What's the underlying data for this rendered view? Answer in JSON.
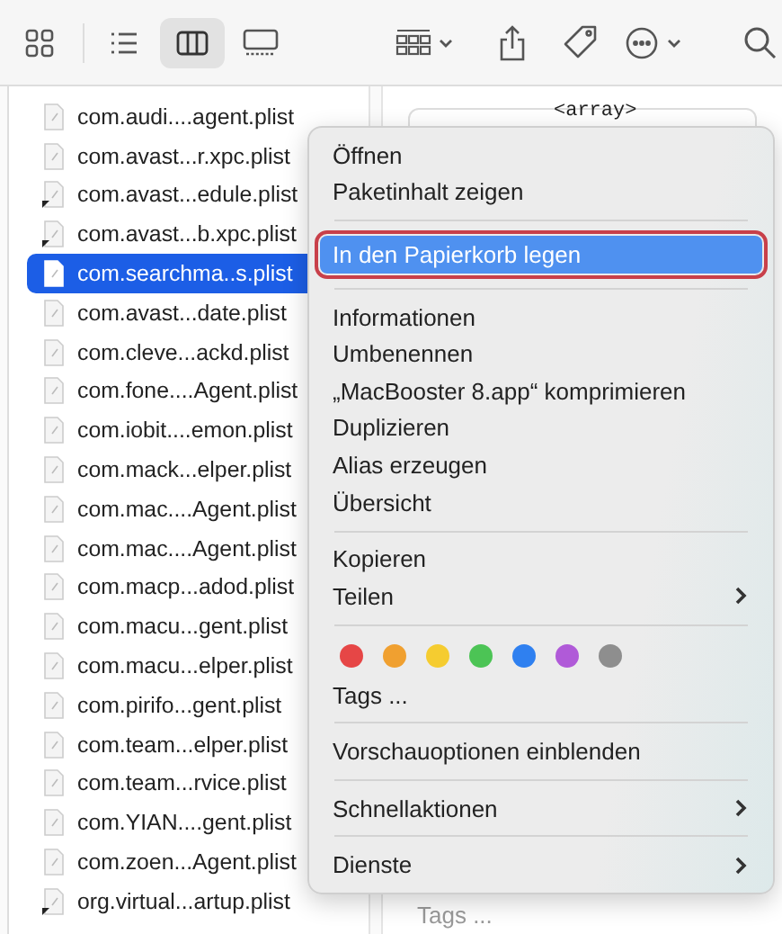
{
  "toolbar": {
    "views": [
      {
        "kind": "icons",
        "selected": false
      },
      {
        "kind": "list",
        "selected": false
      },
      {
        "kind": "columns",
        "selected": true
      },
      {
        "kind": "gallery",
        "selected": false
      }
    ]
  },
  "files": [
    {
      "name": "com.audi....agent.plist",
      "alias": false,
      "selected": false
    },
    {
      "name": "com.avast...r.xpc.plist",
      "alias": false,
      "selected": false
    },
    {
      "name": "com.avast...edule.plist",
      "alias": true,
      "selected": false
    },
    {
      "name": "com.avast...b.xpc.plist",
      "alias": true,
      "selected": false
    },
    {
      "name": "com.searchma..s.plist",
      "alias": false,
      "selected": true
    },
    {
      "name": "com.avast...date.plist",
      "alias": false,
      "selected": false
    },
    {
      "name": "com.cleve...ackd.plist",
      "alias": false,
      "selected": false
    },
    {
      "name": "com.fone....Agent.plist",
      "alias": false,
      "selected": false
    },
    {
      "name": "com.iobit....emon.plist",
      "alias": false,
      "selected": false
    },
    {
      "name": "com.mack...elper.plist",
      "alias": false,
      "selected": false
    },
    {
      "name": "com.mac....Agent.plist",
      "alias": false,
      "selected": false
    },
    {
      "name": "com.mac....Agent.plist",
      "alias": false,
      "selected": false
    },
    {
      "name": "com.macp...adod.plist",
      "alias": false,
      "selected": false
    },
    {
      "name": "com.macu...gent.plist",
      "alias": false,
      "selected": false
    },
    {
      "name": "com.macu...elper.plist",
      "alias": false,
      "selected": false
    },
    {
      "name": "com.pirifo...gent.plist",
      "alias": false,
      "selected": false
    },
    {
      "name": "com.team...elper.plist",
      "alias": false,
      "selected": false
    },
    {
      "name": "com.team...rvice.plist",
      "alias": false,
      "selected": false
    },
    {
      "name": "com.YIAN....gent.plist",
      "alias": false,
      "selected": false
    },
    {
      "name": "com.zoen...Agent.plist",
      "alias": false,
      "selected": false
    },
    {
      "name": "org.virtual...artup.plist",
      "alias": true,
      "selected": false
    }
  ],
  "preview": {
    "lines": [
      "<array>"
    ],
    "tags_label": "Tags ..."
  },
  "context_menu": {
    "items": [
      {
        "kind": "item",
        "label": "Öffnen",
        "selected": false,
        "submenu": false
      },
      {
        "kind": "item",
        "label": "Paketinhalt zeigen",
        "selected": false,
        "submenu": false
      },
      {
        "kind": "separator"
      },
      {
        "kind": "item",
        "label": "In den Papierkorb legen",
        "selected": true,
        "submenu": false
      },
      {
        "kind": "separator"
      },
      {
        "kind": "item",
        "label": "Informationen",
        "selected": false,
        "submenu": false
      },
      {
        "kind": "item",
        "label": "Umbenennen",
        "selected": false,
        "submenu": false
      },
      {
        "kind": "item",
        "label": "„MacBooster 8.app“ komprimieren",
        "selected": false,
        "submenu": false
      },
      {
        "kind": "item",
        "label": "Duplizieren",
        "selected": false,
        "submenu": false
      },
      {
        "kind": "item",
        "label": "Alias erzeugen",
        "selected": false,
        "submenu": false
      },
      {
        "kind": "item",
        "label": "Übersicht",
        "selected": false,
        "submenu": false
      },
      {
        "kind": "separator"
      },
      {
        "kind": "item",
        "label": "Kopieren",
        "selected": false,
        "submenu": false
      },
      {
        "kind": "item",
        "label": "Teilen",
        "selected": false,
        "submenu": true
      },
      {
        "kind": "separator"
      },
      {
        "kind": "tags",
        "colors": [
          {
            "color": "#e64646"
          },
          {
            "color": "#f0a030"
          },
          {
            "color": "#f5cc30"
          },
          {
            "color": "#4cc455"
          },
          {
            "color": "#2f80f0"
          },
          {
            "color": "#b05ad8"
          },
          {
            "color": "#8e8e8e"
          }
        ]
      },
      {
        "kind": "item",
        "label": "Tags ...",
        "selected": false,
        "submenu": false
      },
      {
        "kind": "separator"
      },
      {
        "kind": "item",
        "label": "Vorschauoptionen einblenden",
        "selected": false,
        "submenu": false
      },
      {
        "kind": "separator"
      },
      {
        "kind": "item",
        "label": "Schnellaktionen",
        "selected": false,
        "submenu": true
      },
      {
        "kind": "separator"
      },
      {
        "kind": "item",
        "label": "Dienste",
        "selected": false,
        "submenu": true
      }
    ]
  }
}
